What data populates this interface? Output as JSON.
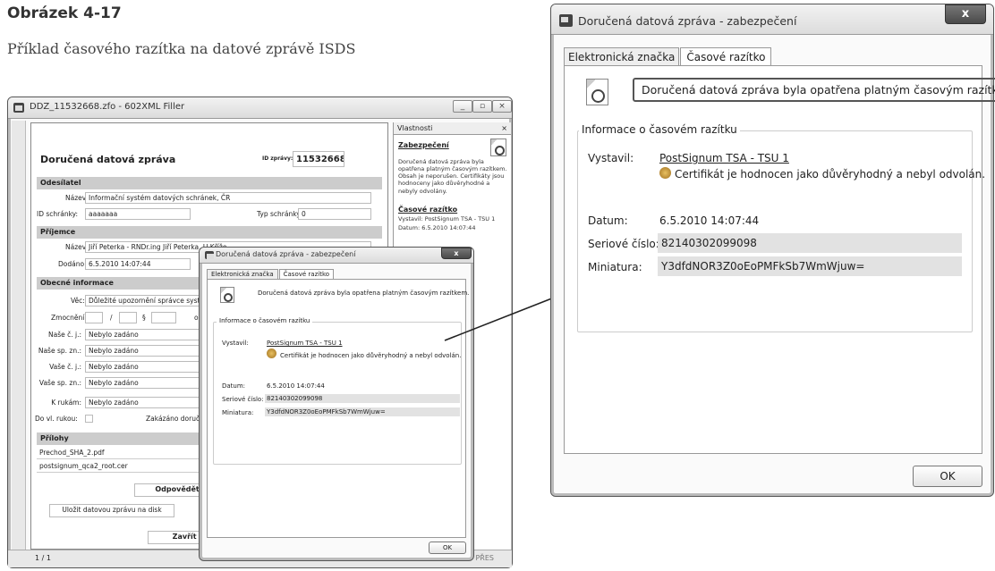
{
  "figure": {
    "number": "Obrázek 4-17",
    "caption": "Příklad časového razítka na datové zprávě ISDS"
  },
  "filler": {
    "title": "DDZ_11532668.zfo - 602XML Filler",
    "doc": {
      "heading": "Doručená datová zpráva",
      "id_label": "ID zprávy:",
      "id_value": "11532668",
      "sender_section": "Odesílatel",
      "name_label": "Název:",
      "sender_name": "Informační systém datových schránek, ČR",
      "box_label": "ID schránky:",
      "box_value": "aaaaaaa",
      "box_type_label": "Typ schránky:",
      "box_type_value": "0",
      "recipient_section": "Příjemce",
      "recipient_name_label": "Název:",
      "recipient_name": "Jiří Peterka - RNDr.ing Jiří Peterka, U Kříže",
      "delivered_label": "Dodáno:",
      "delivered_value": "6.5.2010 14:07:44",
      "general_section": "Obecné informace",
      "subject_label": "Věc:",
      "subject_value": "Důležité upozornění správce systému – nov",
      "auth_label": "Zmocnění:",
      "slash": "/",
      "para": "§",
      "odstavec": "odstavec",
      "rows": [
        {
          "label": "Naše č. j.:",
          "value": "Nebylo zadáno"
        },
        {
          "label": "Naše sp. zn.:",
          "value": "Nebylo zadáno"
        },
        {
          "label": "Vaše č. j.:",
          "value": "Nebylo zadáno"
        },
        {
          "label": "Vaše sp. zn.:",
          "value": "Nebylo zadáno"
        },
        {
          "label": "K rukám:",
          "value": "Nebylo zadáno"
        }
      ],
      "hands_label": "Do vl. rukou:",
      "forbid_label": "Zakázáno doručení fi",
      "attach_section": "Přílohy",
      "attachments": [
        "Prechod_SHA_2.pdf",
        "postsignum_qca2_root.cer"
      ],
      "reply_label": "Odpovědět na",
      "save_label": "Uložit datovou zprávu na disk",
      "close_label": "Zavřít dat"
    },
    "props": {
      "header": "Vlastnosti",
      "security_title": "Zabezpečení",
      "security_text": "Doručená datová zpráva byla opatřena platným časovým razítkem. Obsah je neporušen. Certifikáty jsou hodnoceny jako důvěryhodné a nebyly odvolány.",
      "ts_title": "Časové razítko",
      "ts_issuer": "Vystavil: PostSignum TSA - TSU 1",
      "ts_date": "Datum: 6.5.2010 14:07:44"
    },
    "status_page": "1 / 1",
    "status_right": "PŘES"
  },
  "dialog": {
    "title": "Doručená datová zpráva - zabezpečení",
    "close": "x",
    "tabs": [
      "Elektronická značka",
      "Časové razítko"
    ],
    "message": "Doručená datová zpráva byla opatřena platným časovým razítkem.",
    "group": "Informace o časovém razítku",
    "issuer_label": "Vystavil:",
    "issuer_value": "PostSignum TSA - TSU 1",
    "cert_note": "Certifikát je hodnocen jako důvěryhodný a nebyl odvolán.",
    "date_label": "Datum:",
    "date_value": "6.5.2010 14:07:44",
    "serial_label": "Seriové číslo:",
    "serial_value": "82140302099098",
    "thumb_label": "Miniatura:",
    "thumb_value": "Y3dfdNOR3Z0oEoPMFkSb7WmWjuw=",
    "ok": "OK"
  }
}
